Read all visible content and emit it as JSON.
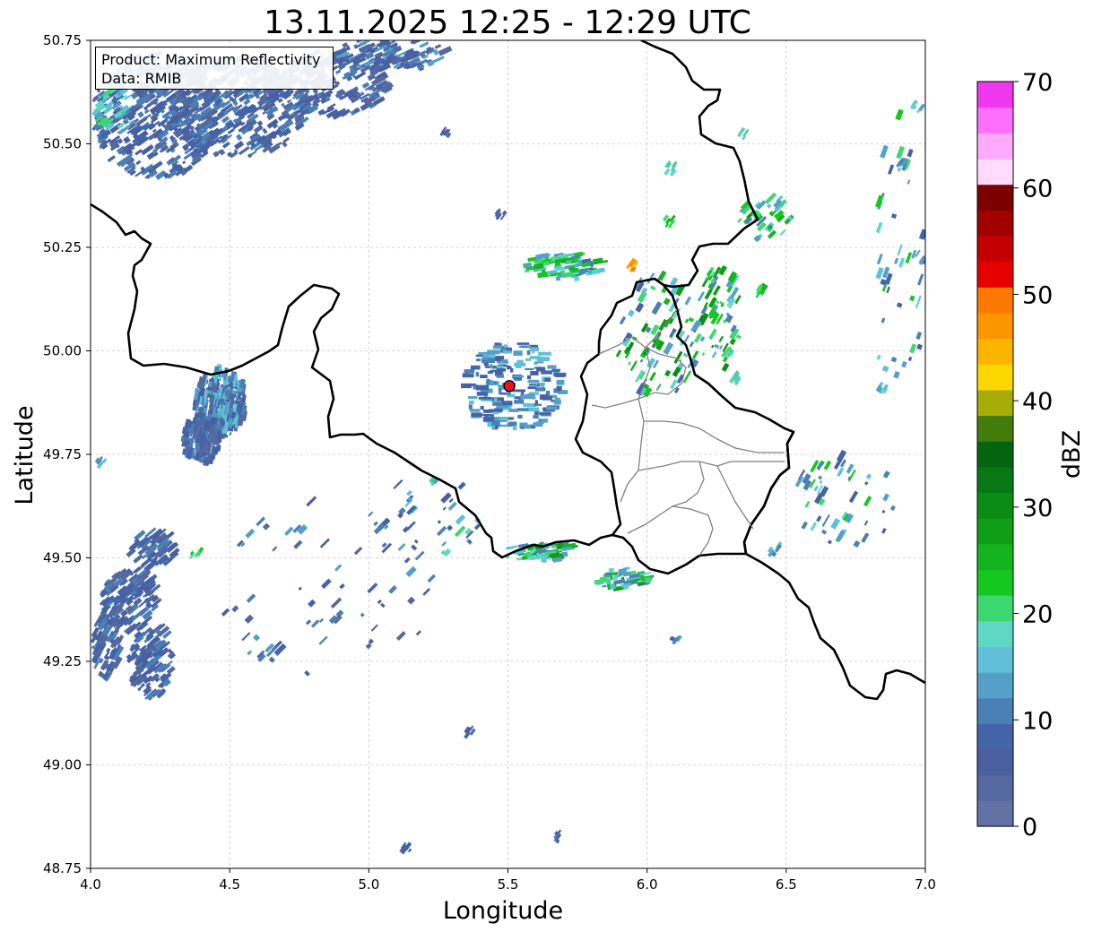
{
  "title": "13.11.2025 12:25 - 12:29 UTC",
  "info_box": {
    "product": "Product: Maximum Reflectivity",
    "data": "Data: RMIB"
  },
  "axes": {
    "xlabel": "Longitude",
    "ylabel": "Latitude",
    "xlim": [
      4.0,
      7.0
    ],
    "ylim": [
      48.75,
      50.75
    ],
    "xticks": [
      "4.0",
      "4.5",
      "5.0",
      "5.5",
      "6.0",
      "6.5",
      "7.0"
    ],
    "yticks": [
      "48.75",
      "49.00",
      "49.25",
      "49.50",
      "49.75",
      "50.00",
      "50.25",
      "50.50",
      "50.75"
    ],
    "grid": true
  },
  "colorbar": {
    "label": "dBZ",
    "min": 0,
    "max": 70,
    "tick_labels": [
      "0",
      "10",
      "20",
      "30",
      "40",
      "50",
      "60",
      "70"
    ],
    "colors": [
      "#6272a4",
      "#55689f",
      "#4a5fa0",
      "#4464a8",
      "#4a80b4",
      "#54a0c8",
      "#60c0d8",
      "#5ed8c4",
      "#3ed870",
      "#14c820",
      "#14b41e",
      "#0e9e16",
      "#0b8c14",
      "#087814",
      "#056410",
      "#447c0c",
      "#a8ac08",
      "#fcd800",
      "#fcb400",
      "#fc9600",
      "#fc7800",
      "#e60000",
      "#c40000",
      "#a20000",
      "#7c0000",
      "#ffdcff",
      "#ffaaff",
      "#ff6eff",
      "#ee38ee"
    ]
  },
  "radar_site": {
    "lon": 5.505,
    "lat": 49.915,
    "color": "#e8141c"
  },
  "colors": {
    "border": "#000000",
    "provinces": "#808080",
    "grid": "#b0b0b0"
  }
}
